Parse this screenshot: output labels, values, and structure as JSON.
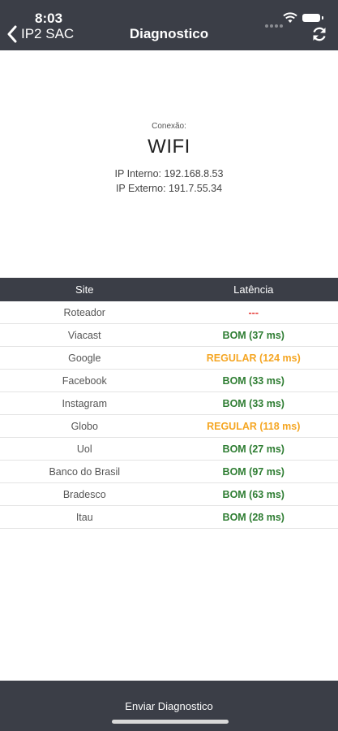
{
  "status_bar": {
    "time": "8:03"
  },
  "nav": {
    "back_label": "IP2 SAC",
    "title": "Diagnostico"
  },
  "connection": {
    "label": "Conexão:",
    "type": "WIFI",
    "ip_internal": "IP Interno: 192.168.8.53",
    "ip_external": "IP Externo: 191.7.55.34"
  },
  "table": {
    "headers": {
      "site": "Site",
      "latency": "Latência"
    },
    "rows": [
      {
        "site": "Roteador",
        "latency": "---",
        "color": "#e53935"
      },
      {
        "site": "Viacast",
        "latency": "BOM (37 ms)",
        "color": "#2e7d32"
      },
      {
        "site": "Google",
        "latency": "REGULAR (124 ms)",
        "color": "#f5a623"
      },
      {
        "site": "Facebook",
        "latency": "BOM (33 ms)",
        "color": "#2e7d32"
      },
      {
        "site": "Instagram",
        "latency": "BOM (33 ms)",
        "color": "#2e7d32"
      },
      {
        "site": "Globo",
        "latency": "REGULAR (118 ms)",
        "color": "#f5a623"
      },
      {
        "site": "Uol",
        "latency": "BOM (27 ms)",
        "color": "#2e7d32"
      },
      {
        "site": "Banco do Brasil",
        "latency": "BOM (97 ms)",
        "color": "#2e7d32"
      },
      {
        "site": "Bradesco",
        "latency": "BOM (63 ms)",
        "color": "#2e7d32"
      },
      {
        "site": "Itau",
        "latency": "BOM (28 ms)",
        "color": "#2e7d32"
      }
    ]
  },
  "footer": {
    "send_label": "Enviar Diagnostico"
  },
  "colors": {
    "bar": "#3b3e47",
    "good": "#2e7d32",
    "regular": "#f5a623",
    "bad": "#e53935"
  }
}
